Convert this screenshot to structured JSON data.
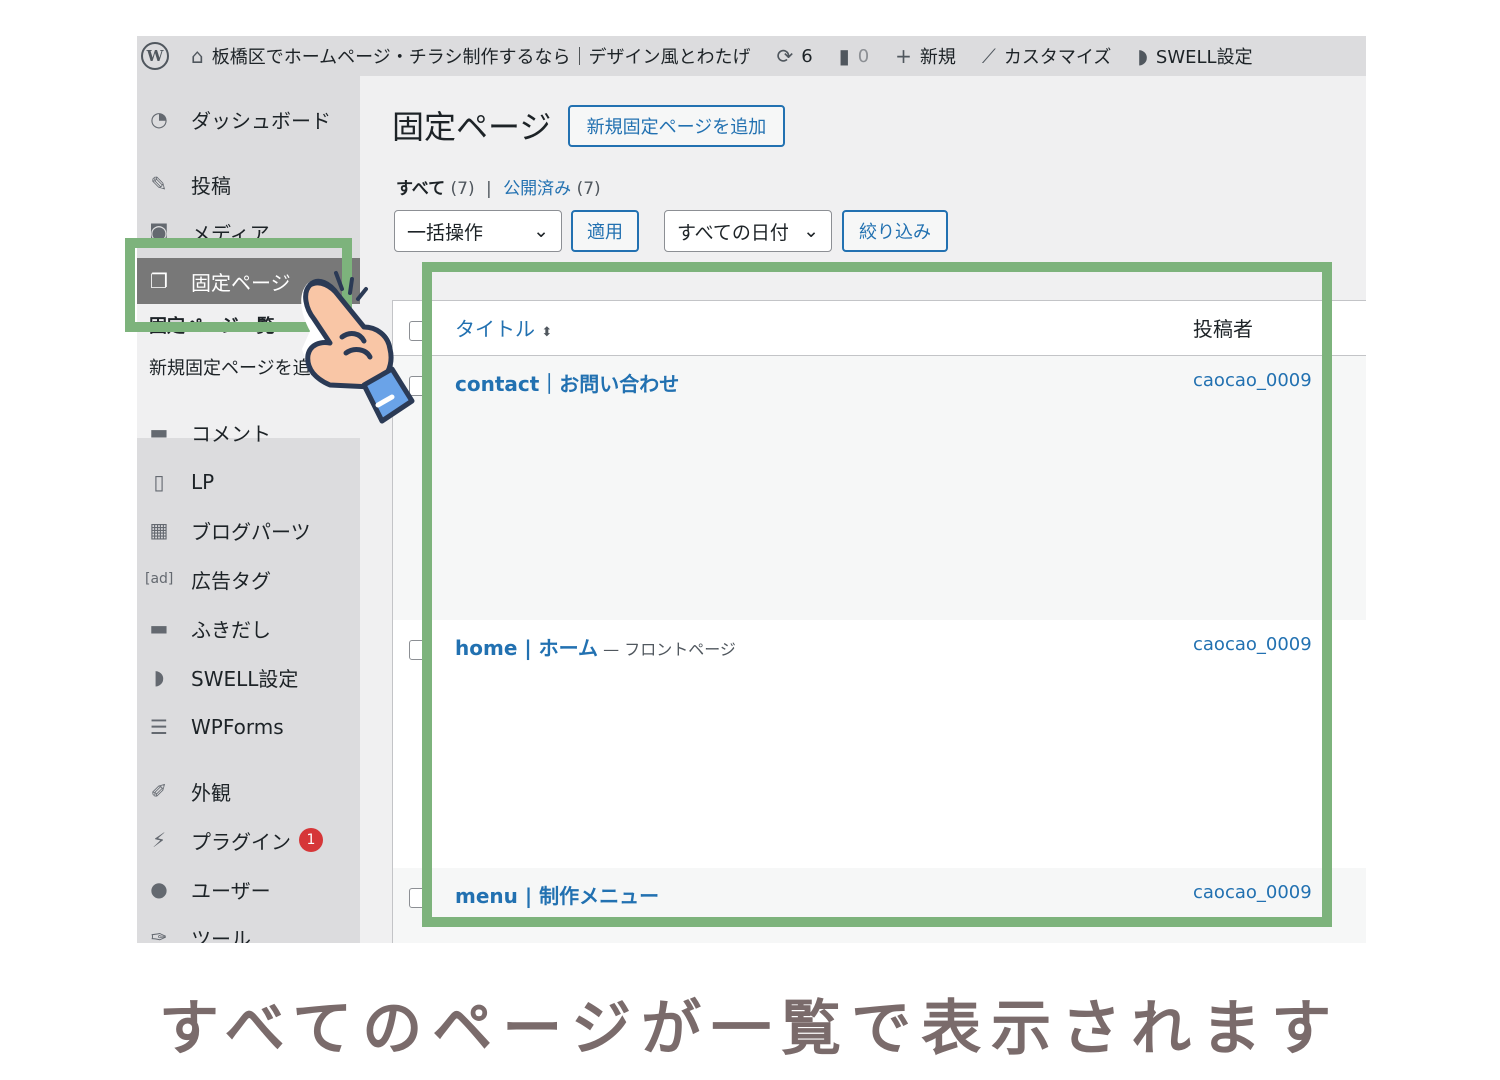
{
  "adminbar": {
    "site_name": "板橋区でホームページ・チラシ制作するなら｜デザイン風とわたげ",
    "updates": "6",
    "comments": "0",
    "new_label": "新規",
    "customize_label": "カスタマイズ",
    "swell_label": "SWELL設定"
  },
  "sidebar": {
    "dashboard": "ダッシュボード",
    "posts": "投稿",
    "media": "メディア",
    "pages": "固定ページ",
    "pages_sub_all": "固定ページ一覧",
    "pages_sub_new": "新規固定ページを追加",
    "comments": "コメント",
    "lp": "LP",
    "blog_parts": "ブログパーツ",
    "ad_tag_icon": "[ad]",
    "ad_tags": "広告タグ",
    "balloons": "ふきだし",
    "swell": "SWELL設定",
    "wpforms": "WPForms",
    "appearance": "外観",
    "plugins": "プラグイン",
    "plugins_badge": "1",
    "users": "ユーザー",
    "tools": "ツール"
  },
  "main": {
    "title": "固定ページ",
    "add_new": "新規固定ページを追加",
    "filter_all": "すべて",
    "filter_all_count": "(7)",
    "filter_sep": "|",
    "filter_published": "公開済み",
    "filter_published_count": "(7)",
    "bulk_action": "一括操作",
    "apply": "適用",
    "all_dates": "すべての日付",
    "filter_button": "絞り込み"
  },
  "table": {
    "col_title": "タイトル",
    "col_author": "投稿者",
    "rows": [
      {
        "title": "contact｜お問い合わせ",
        "state": "",
        "author": "caocao_0009"
      },
      {
        "title": "home | ホーム",
        "state": " — フロントページ",
        "author": "caocao_0009"
      },
      {
        "title": "menu | 制作メニュー",
        "state": "",
        "author": "caocao_0009"
      }
    ]
  },
  "caption": "すべてのページが一覧で表示されます",
  "colors": {
    "highlight": "#7db37c",
    "link": "#2271b1",
    "sidebar": "#dcdcde",
    "active_menu": "#787878"
  }
}
